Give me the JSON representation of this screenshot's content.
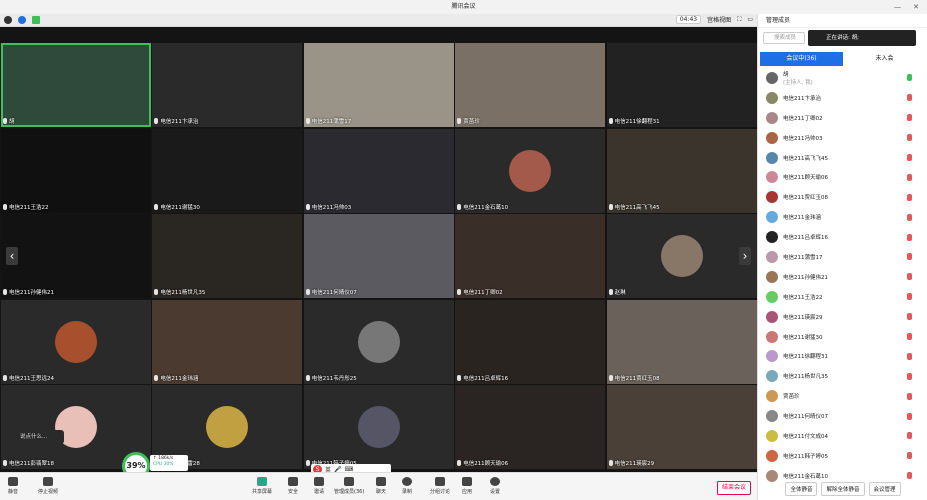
{
  "window": {
    "title": "腾讯会议"
  },
  "toolbar": {
    "time": "04:43",
    "view_label": "宫格视图"
  },
  "sidebar": {
    "header": "管理成员",
    "search_placeholder": "搜索成员",
    "speaking": "正在讲话: 胡;",
    "tab_in": "会议中(36)",
    "tab_out": "未入会",
    "members": [
      {
        "name": "胡",
        "sub": "(主持人, 我)",
        "color": "#666",
        "mic_on": true
      },
      {
        "name": "电信211卞承治",
        "color": "#886"
      },
      {
        "name": "电信211丁卿02",
        "color": "#a88"
      },
      {
        "name": "电信211冯帅03",
        "color": "#a64"
      },
      {
        "name": "电信211高飞飞45",
        "color": "#58a"
      },
      {
        "name": "电信211顾天瑜06",
        "color": "#c89"
      },
      {
        "name": "电信211贾红玉08",
        "color": "#a33"
      },
      {
        "name": "电信211金玮涵",
        "color": "#6ad"
      },
      {
        "name": "电信211吕卓辉16",
        "color": "#222"
      },
      {
        "name": "电信211蒲雪17",
        "color": "#b9a"
      },
      {
        "name": "电信211孙健伟21",
        "color": "#975"
      },
      {
        "name": "电信211王浩22",
        "color": "#6c6"
      },
      {
        "name": "电信211瑛宸29",
        "color": "#a57"
      },
      {
        "name": "电信211谢猛30",
        "color": "#c77"
      },
      {
        "name": "电信211徐翻程31",
        "color": "#b9c"
      },
      {
        "name": "电信211杨世凡35",
        "color": "#7ab"
      },
      {
        "name": "贾菡珍",
        "color": "#c95"
      },
      {
        "name": "电信211何晴仪07",
        "color": "#888"
      },
      {
        "name": "电信211付文成04",
        "color": "#cb4"
      },
      {
        "name": "电信211韩子婷05",
        "color": "#c64"
      },
      {
        "name": "电信211金石葛10",
        "color": "#a87"
      }
    ],
    "mute_all": "全体静音",
    "unmute_all": "解除全体静音",
    "manage": "会议管理"
  },
  "tiles": [
    {
      "name": "胡",
      "bg": "#2f4a3a",
      "border": "#3fbf5a"
    },
    {
      "name": "电信211卞承治",
      "bg": "#2a2a2a"
    },
    {
      "name": "电信211蒲雪17",
      "bg": "#9a9488"
    },
    {
      "name": "贾菡珍",
      "bg": "#7a7066"
    },
    {
      "name": "电信211徐翻程31",
      "bg": "#222"
    },
    {
      "name": "电信211王浩22",
      "bg": "#101010"
    },
    {
      "name": "电信211谢猛30",
      "bg": "#1a1a1a"
    },
    {
      "name": "电信211冯帅03",
      "bg": "#2a2a30"
    },
    {
      "name": "电信211金石葛10",
      "bg": "#2a2a2a",
      "avatar": "#a35a4a"
    },
    {
      "name": "电信211高飞飞45",
      "bg": "#3a342c"
    },
    {
      "name": "电信211孙健伟21",
      "bg": "#121212"
    },
    {
      "name": "电信211杨世凡35",
      "bg": "#2a2722"
    },
    {
      "name": "电信211何晴仪07",
      "bg": "#5a5a60"
    },
    {
      "name": "电信211丁卿02",
      "bg": "#3a2e28"
    },
    {
      "name": "赵琳",
      "bg": "#2a2a2a",
      "avatar": "#887766"
    },
    {
      "name": "电信211王思远24",
      "bg": "#2a2a2a",
      "avatar": "#a8502e"
    },
    {
      "name": "电信211金玮涵",
      "bg": "#4a3a30"
    },
    {
      "name": "电信211韦丹彤25",
      "bg": "#2a2a2a",
      "avatar": "#777"
    },
    {
      "name": "电信211吕卓辉16",
      "bg": "#2a2420"
    },
    {
      "name": "电信211贾红玉08",
      "bg": "#6a625a"
    },
    {
      "name": "电信211彭翡翠18",
      "bg": "#2a2a2a",
      "avatar": "#e8c0b8"
    },
    {
      "name": "电信211陈雷28",
      "bg": "#2a2a2a",
      "avatar": "#c0a040"
    },
    {
      "name": "电信211韩子婷05",
      "bg": "#2a2a2a",
      "avatar": "#556"
    },
    {
      "name": "电信211顾天瑜06",
      "bg": "#2a2522"
    },
    {
      "name": "电信211瑛宸29",
      "bg": "#4a4038"
    }
  ],
  "overlay": {
    "percent": "39%",
    "perf_line1": "↑ 186k/s",
    "perf_line2": "CPU 30%",
    "chat": "说点什么...",
    "ime": "英"
  },
  "bottom": {
    "mute": "静音",
    "stop_video": "停止视频",
    "share": "共享屏幕",
    "security": "安全",
    "invite": "邀请",
    "members": "管理成员(36)",
    "chat": "聊天",
    "record": "录制",
    "breakout": "分组讨论",
    "apps": "应用",
    "settings": "设置",
    "end": "结束会议"
  }
}
